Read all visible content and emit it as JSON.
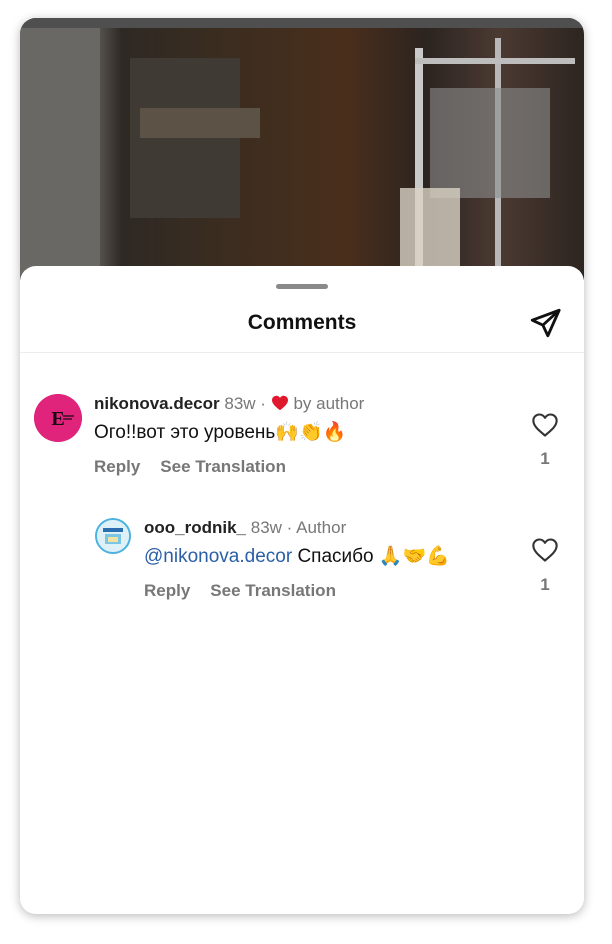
{
  "sheet": {
    "title": "Comments"
  },
  "comments": [
    {
      "username": "nikonova.decor",
      "time": "83w",
      "separator": "·",
      "author_tag": "by author",
      "text": "Ого!!вот это уровень",
      "emojis": "🙌👏🔥",
      "reply": "Reply",
      "translate": "See Translation",
      "likes": "1"
    },
    {
      "username": "ooo_rodnik_",
      "time": "83w",
      "separator": "·",
      "author_tag": "Author",
      "mention": "@nikonova.decor",
      "text": "Спасибо",
      "emojis": "🙏🤝💪",
      "reply": "Reply",
      "translate": "See Translation",
      "likes": "1"
    }
  ],
  "icons": {
    "send": "send-icon",
    "like": "heart-outline-icon",
    "author_heart": "heart-filled-icon"
  },
  "colors": {
    "mention": "#2a5fa8",
    "heart": "#e0182d",
    "avatar1": "#e0247b"
  }
}
